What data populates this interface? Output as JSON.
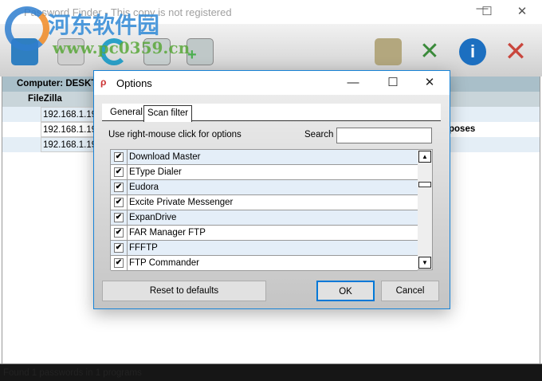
{
  "window": {
    "title": "Password Finder - This copy is not registered",
    "minimize": "—",
    "maximize": "☐",
    "close": "✕"
  },
  "watermark": {
    "name": "河东软件园",
    "url": "www.pc0359.cn"
  },
  "toolbar": {
    "icons": [
      "save-icon",
      "print-icon",
      "refresh-icon",
      "search-icon",
      "add-computer-icon",
      "lock-icon",
      "tools-icon",
      "info-icon",
      "exit-icon"
    ],
    "colors": {
      "save": "#2f7fc1",
      "print": "#c8c8c8",
      "refresh": "#2aa0c8",
      "search": "#9aa",
      "add": "#4caf50",
      "lock": "#9c8f6a",
      "tools": "#4a9e3a",
      "info": "#1c6fc0",
      "exit": "#c9463d"
    }
  },
  "tree": {
    "computer": "Computer: DESKT",
    "program": "FileZilla",
    "rows": [
      "192.168.1.19",
      "192.168.1.19",
      "192.168.1.19"
    ],
    "partial_text": "poses"
  },
  "status": "Found 1 passwords in 1 programs",
  "dialog": {
    "title": "Options",
    "tabs": [
      "General",
      "Scan filter"
    ],
    "hint": "Use right-mouse click for options",
    "search_label": "Search",
    "search_value": "",
    "items": [
      {
        "label": "Download Master",
        "checked": true
      },
      {
        "label": "EType Dialer",
        "checked": true
      },
      {
        "label": "Eudora",
        "checked": true
      },
      {
        "label": "Excite Private Messenger",
        "checked": true
      },
      {
        "label": "ExpanDrive",
        "checked": true
      },
      {
        "label": "FAR Manager FTP",
        "checked": true
      },
      {
        "label": "FFFTP",
        "checked": true
      },
      {
        "label": "FTP Commander",
        "checked": true
      }
    ],
    "reset": "Reset to defaults",
    "ok": "OK",
    "cancel": "Cancel",
    "check_glyph": "✔"
  }
}
